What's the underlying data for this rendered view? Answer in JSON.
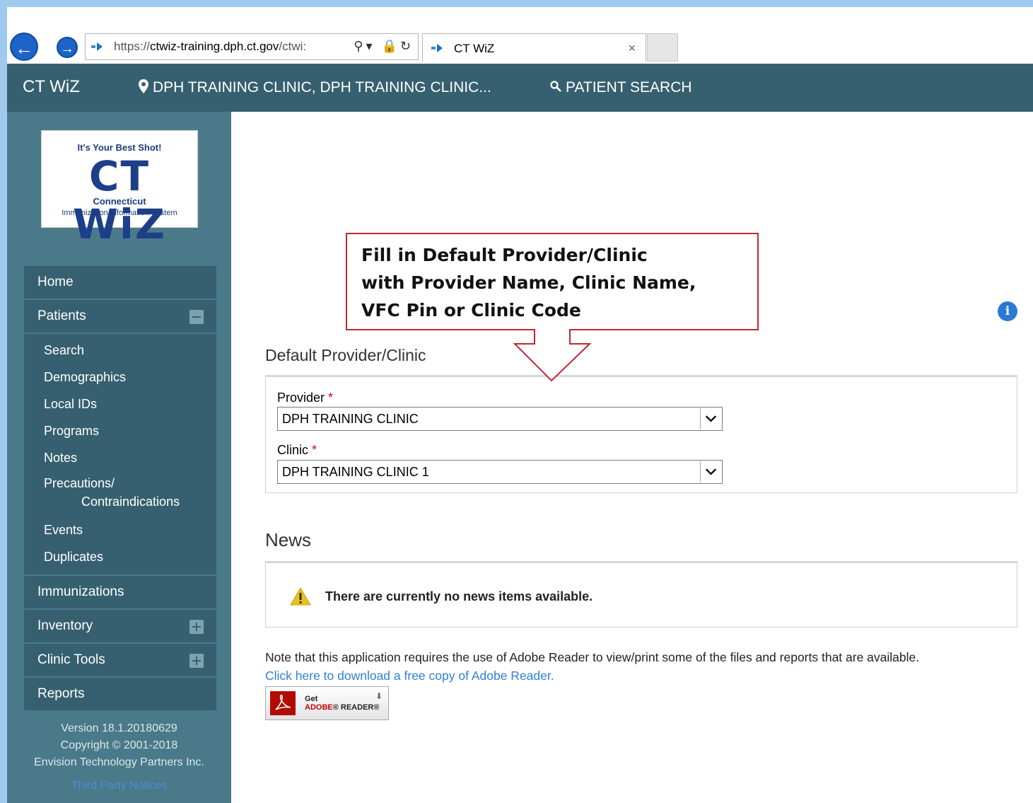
{
  "browser": {
    "url_host": "https://ctwiz-training.dph.ct.gov",
    "url_path": "/ctwi:",
    "url_scheme_label": "https://",
    "url_host_only": "ctwiz-training.dph.ct.gov",
    "tab_title": "CT WiZ",
    "tab_close": "×"
  },
  "header": {
    "brand": "CT WiZ",
    "location": "DPH TRAINING CLINIC, DPH TRAINING CLINIC...",
    "patient_search": "PATIENT SEARCH"
  },
  "logo": {
    "tagline": "It's Your Best Shot!",
    "main": "CT WiZ",
    "state": "Connecticut",
    "system": "Immunization Information System"
  },
  "sidebar": {
    "home": "Home",
    "patients": "Patients",
    "patient_items": [
      "Search",
      "Demographics",
      "Local IDs",
      "Programs",
      "Notes"
    ],
    "precautions_line1": "Precautions/",
    "precautions_line2": "Contraindications",
    "patient_items2": [
      "Events",
      "Duplicates"
    ],
    "immunizations": "Immunizations",
    "inventory": "Inventory",
    "clinic_tools": "Clinic Tools",
    "reports": "Reports",
    "version": "Version 18.1.20180629",
    "copyright": "Copyright © 2001-2018",
    "company": "Envision Technology Partners Inc.",
    "third_party": "Third Party Notices"
  },
  "callout": {
    "line1": "Fill in Default Provider/Clinic",
    "line2": "with Provider Name, Clinic Name,",
    "line3": "VFC Pin or Clinic Code"
  },
  "default_provider": {
    "title": "Default Provider/Clinic",
    "provider_label": "Provider",
    "provider_value": "DPH TRAINING CLINIC",
    "clinic_label": "Clinic",
    "clinic_value": "DPH TRAINING CLINIC 1",
    "required_mark": "*"
  },
  "news": {
    "title": "News",
    "message": "There are currently no news items available."
  },
  "footer": {
    "note": "Note that this application requires the use of Adobe Reader to view/print some of the files and reports that are available.",
    "download_link": "Click here to download a free copy of Adobe Reader.",
    "adobe_get": "Get",
    "adobe_brand": "ADOBE",
    "adobe_product": "READER"
  },
  "colors": {
    "header_bg": "#36606f",
    "sidebar_bg": "#4a7a89",
    "link": "#2f7fd8",
    "callout_border": "#c0282f"
  }
}
